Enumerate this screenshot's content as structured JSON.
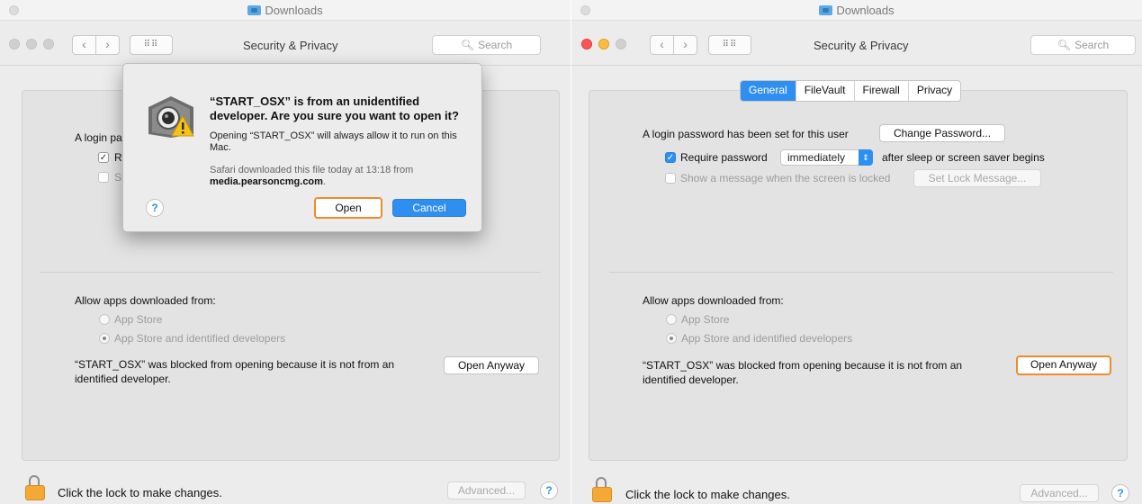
{
  "background_window": {
    "title": "Downloads"
  },
  "window": {
    "title": "Security & Privacy",
    "search_placeholder": "Search",
    "nav_back": "‹",
    "nav_forward": "›",
    "grid_glyph": "⠿⠿"
  },
  "tabs": [
    {
      "label": "General",
      "active": true
    },
    {
      "label": "FileVault",
      "active": false
    },
    {
      "label": "Firewall",
      "active": false
    },
    {
      "label": "Privacy",
      "active": false
    }
  ],
  "login": {
    "label": "A login password has been set for this user",
    "label_truncated": "A login pa",
    "change_password_button": "Change Password...",
    "require_password_label": "Require password",
    "require_password_truncated": "Re",
    "require_password_checked": true,
    "require_password_value": "immediately",
    "after_sleep_label": "after sleep or screen saver begins",
    "show_message_label": "Show a message when the screen is locked",
    "show_message_truncated": "Sh",
    "show_message_checked": false,
    "set_lock_message_button": "Set Lock Message..."
  },
  "apps": {
    "heading": "Allow apps downloaded from:",
    "options": [
      {
        "label": "App Store",
        "selected": false
      },
      {
        "label": "App Store and identified developers",
        "selected": true
      }
    ],
    "blocked_message_line1": "“START_OSX” was blocked from opening because it is not from an",
    "blocked_message_line2": "identified developer.",
    "open_anyway_button": "Open Anyway"
  },
  "footer": {
    "lock_text": "Click the lock to make changes.",
    "advanced_button": "Advanced...",
    "help": "?"
  },
  "dialog": {
    "title": "“START_OSX” is from an unidentified developer. Are you sure you want to open it?",
    "body": "Opening “START_OSX” will always allow it to run on this Mac.",
    "source_prefix": "Safari downloaded this file today at 13:18 from",
    "source_domain": "media.pearsoncmg.com",
    "source_suffix": ".",
    "open_button": "Open",
    "cancel_button": "Cancel",
    "help": "?"
  },
  "colors": {
    "accent": "#2f8ff0",
    "highlight": "#f08a2a",
    "lock": "#f4a937"
  }
}
